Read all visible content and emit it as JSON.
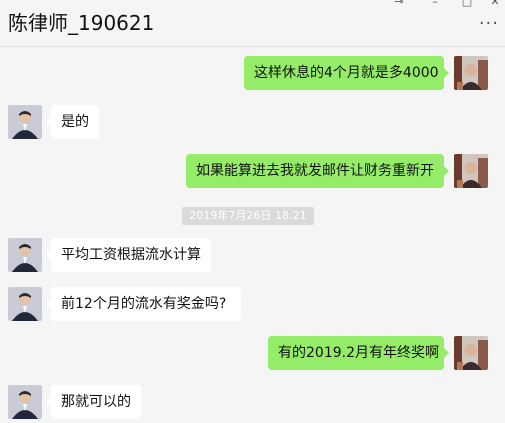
{
  "window": {
    "title": "陈律师_190621",
    "controls": {
      "pin": "⊸",
      "minimize": "–",
      "maximize": "□",
      "close": "✕",
      "more": "···"
    }
  },
  "colors": {
    "background": "#f5f5f5",
    "incoming_bubble": "#ffffff",
    "outgoing_bubble": "#95ec69",
    "timestamp_bg": "#dadada"
  },
  "messages": [
    {
      "direction": "out",
      "text": "这样休息的4个月就是多4000"
    },
    {
      "direction": "in",
      "text": "是的"
    },
    {
      "direction": "out",
      "text": "如果能算进去我就发邮件让财务重新开"
    },
    {
      "direction": "timestamp",
      "text": "2019年7月26日 18:21"
    },
    {
      "direction": "in",
      "text": "平均工资根据流水计算"
    },
    {
      "direction": "in",
      "text": "前12个月的流水有奖金吗?"
    },
    {
      "direction": "out",
      "text": "有的2019.2月有年终奖啊"
    },
    {
      "direction": "in",
      "text": "那就可以的"
    }
  ]
}
